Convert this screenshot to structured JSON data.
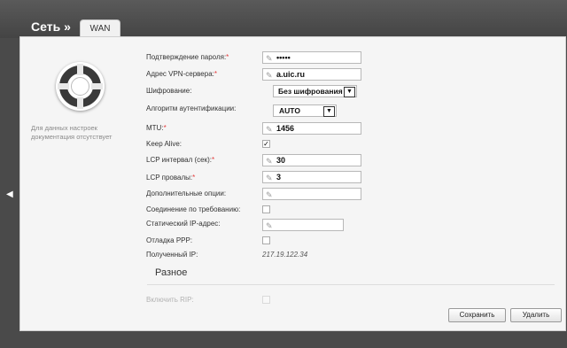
{
  "header": {
    "section_title": "Сеть »",
    "tab_label": "WAN"
  },
  "side": {
    "note": "Для данных настроек документация отсутствует"
  },
  "form": {
    "password_confirm": {
      "label": "Подтверждение пароля:",
      "required": "*",
      "value": "•••••"
    },
    "vpn_server": {
      "label": "Адрес VPN-сервера:",
      "required": "*",
      "value": "a.uic.ru"
    },
    "encryption": {
      "label": "Шифрование:",
      "value": "Без шифрования"
    },
    "auth_algo": {
      "label": "Алгоритм аутентификации:",
      "value": "AUTO"
    },
    "mtu": {
      "label": "MTU:",
      "required": "*",
      "value": "1456"
    },
    "keep_alive": {
      "label": "Keep Alive:",
      "checked": true,
      "mark": "✓"
    },
    "lcp_interval": {
      "label": "LCP интервал (сек):",
      "required": "*",
      "value": "30"
    },
    "lcp_fails": {
      "label": "LCP провалы:",
      "required": "*",
      "value": "3"
    },
    "extra_options": {
      "label": "Дополнительные опции:",
      "value": ""
    },
    "on_demand": {
      "label": "Соединение по требованию:",
      "checked": false
    },
    "static_ip": {
      "label": "Статический IP-адрес:",
      "value": ""
    },
    "ppp_debug": {
      "label": "Отладка PPP:",
      "checked": false
    },
    "received_ip": {
      "label": "Полученный IP:",
      "value": "217.19.122.34"
    }
  },
  "misc": {
    "title": "Разное",
    "rip_label": "Включить RIP:"
  },
  "buttons": {
    "save": "Сохранить",
    "delete": "Удалить"
  },
  "icons": {
    "edit": "pencil-icon",
    "dropdown": "chevron-down-icon",
    "back": "chevron-left-icon",
    "help": "lifebuoy-icon"
  }
}
